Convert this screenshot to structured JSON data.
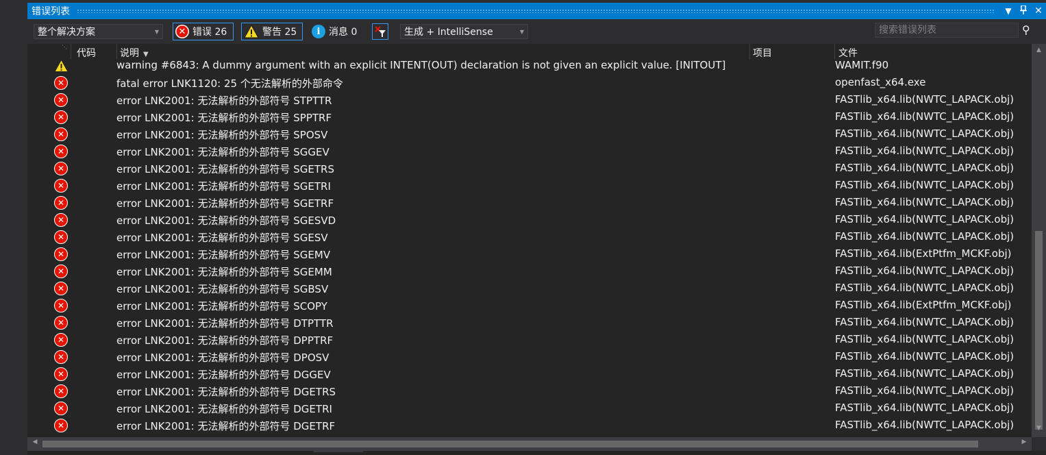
{
  "window": {
    "title": "错误列表"
  },
  "toolbar": {
    "scope": "整个解决方案",
    "errors_label": "错误 26",
    "warnings_label": "警告 25",
    "messages_label": "消息 0",
    "build_filter": "生成 + IntelliSense",
    "search_placeholder": "搜索错误列表"
  },
  "columns": {
    "code": "代码",
    "description": "说明",
    "project": "项目",
    "file": "文件"
  },
  "rows": [
    {
      "severity": "warning",
      "description": "warning #6843: A dummy argument with an explicit INTENT(OUT) declaration is not given an explicit value.   [INITOUT]",
      "file": "WAMIT.f90"
    },
    {
      "severity": "error",
      "description": "fatal error LNK1120: 25 个无法解析的外部命令",
      "file": "openfast_x64.exe"
    },
    {
      "severity": "error",
      "description": "error LNK2001: 无法解析的外部符号 STPTTR",
      "file": "FASTlib_x64.lib(NWTC_LAPACK.obj)"
    },
    {
      "severity": "error",
      "description": "error LNK2001: 无法解析的外部符号 SPPTRF",
      "file": "FASTlib_x64.lib(NWTC_LAPACK.obj)"
    },
    {
      "severity": "error",
      "description": "error LNK2001: 无法解析的外部符号 SPOSV",
      "file": "FASTlib_x64.lib(NWTC_LAPACK.obj)"
    },
    {
      "severity": "error",
      "description": "error LNK2001: 无法解析的外部符号 SGGEV",
      "file": "FASTlib_x64.lib(NWTC_LAPACK.obj)"
    },
    {
      "severity": "error",
      "description": "error LNK2001: 无法解析的外部符号 SGETRS",
      "file": "FASTlib_x64.lib(NWTC_LAPACK.obj)"
    },
    {
      "severity": "error",
      "description": "error LNK2001: 无法解析的外部符号 SGETRI",
      "file": "FASTlib_x64.lib(NWTC_LAPACK.obj)"
    },
    {
      "severity": "error",
      "description": "error LNK2001: 无法解析的外部符号 SGETRF",
      "file": "FASTlib_x64.lib(NWTC_LAPACK.obj)"
    },
    {
      "severity": "error",
      "description": "error LNK2001: 无法解析的外部符号 SGESVD",
      "file": "FASTlib_x64.lib(NWTC_LAPACK.obj)"
    },
    {
      "severity": "error",
      "description": "error LNK2001: 无法解析的外部符号 SGESV",
      "file": "FASTlib_x64.lib(NWTC_LAPACK.obj)"
    },
    {
      "severity": "error",
      "description": "error LNK2001: 无法解析的外部符号 SGEMV",
      "file": "FASTlib_x64.lib(ExtPtfm_MCKF.obj)"
    },
    {
      "severity": "error",
      "description": "error LNK2001: 无法解析的外部符号 SGEMM",
      "file": "FASTlib_x64.lib(NWTC_LAPACK.obj)"
    },
    {
      "severity": "error",
      "description": "error LNK2001: 无法解析的外部符号 SGBSV",
      "file": "FASTlib_x64.lib(NWTC_LAPACK.obj)"
    },
    {
      "severity": "error",
      "description": "error LNK2001: 无法解析的外部符号 SCOPY",
      "file": "FASTlib_x64.lib(ExtPtfm_MCKF.obj)"
    },
    {
      "severity": "error",
      "description": "error LNK2001: 无法解析的外部符号 DTPTTR",
      "file": "FASTlib_x64.lib(NWTC_LAPACK.obj)"
    },
    {
      "severity": "error",
      "description": "error LNK2001: 无法解析的外部符号 DPPTRF",
      "file": "FASTlib_x64.lib(NWTC_LAPACK.obj)"
    },
    {
      "severity": "error",
      "description": "error LNK2001: 无法解析的外部符号 DPOSV",
      "file": "FASTlib_x64.lib(NWTC_LAPACK.obj)"
    },
    {
      "severity": "error",
      "description": "error LNK2001: 无法解析的外部符号 DGGEV",
      "file": "FASTlib_x64.lib(NWTC_LAPACK.obj)"
    },
    {
      "severity": "error",
      "description": "error LNK2001: 无法解析的外部符号 DGETRS",
      "file": "FASTlib_x64.lib(NWTC_LAPACK.obj)"
    },
    {
      "severity": "error",
      "description": "error LNK2001: 无法解析的外部符号 DGETRI",
      "file": "FASTlib_x64.lib(NWTC_LAPACK.obj)"
    },
    {
      "severity": "error",
      "description": "error LNK2001: 无法解析的外部符号 DGETRF",
      "file": "FASTlib_x64.lib(NWTC_LAPACK.obj)"
    }
  ],
  "colors": {
    "accent": "#007acc",
    "error": "#e51400",
    "warning": "#f8d820",
    "info": "#1ba1e2",
    "background": "#252526"
  },
  "icons": [
    "close-icon",
    "pin-icon",
    "dropdown-icon",
    "error-icon",
    "warning-icon",
    "info-icon",
    "clear-filter-icon",
    "search-icon"
  ]
}
